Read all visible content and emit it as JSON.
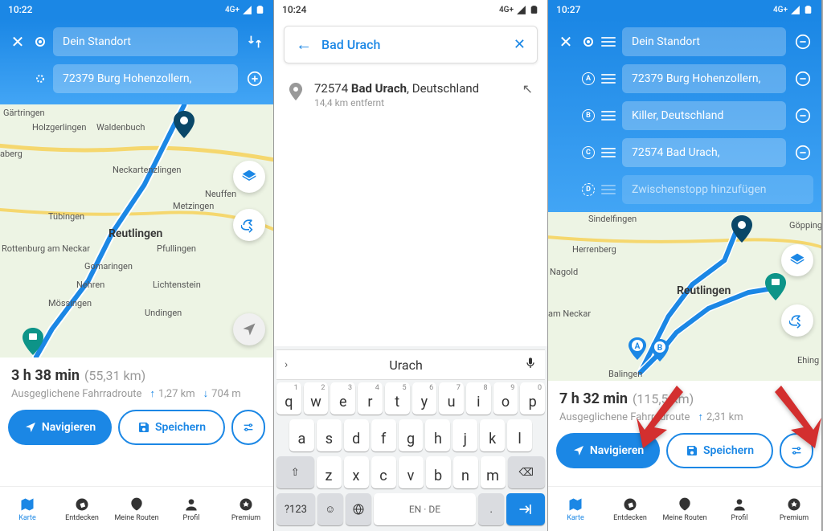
{
  "status": {
    "t1": "10:22",
    "t2": "10:24",
    "t3": "10:27",
    "net": "4G+"
  },
  "p1": {
    "origin": "Dein Standort",
    "dest": "72379 Burg Hohenzollern,",
    "cities": {
      "gartringen": "Gärtringen",
      "holzgerlingen": "Holzgerlingen",
      "waldenbuch": "Waldenbuch",
      "neckartenzlingen": "Neckartenzlingen",
      "metzingen": "Metzingen",
      "tubingen": "Tübingen",
      "reutlingen": "Reutlingen",
      "pfullingen": "Pfullingen",
      "rottenburg": "Rottenburg am Neckar",
      "gomaringen": "Gomaringen",
      "nehren": "Nehren",
      "lichtenstein": "Lichtenstein",
      "mossingen": "Mössingen",
      "undingen": "Undingen",
      "neuffen": "Neuffen",
      "aberg": "aberg"
    },
    "stats": {
      "time": "3 h 38 min",
      "dist": "(55,31 km)",
      "type": "Ausgeglichene Fahrradroute",
      "up": "1,27 km",
      "down": "704 m"
    },
    "nav": "Navigieren",
    "save": "Speichern"
  },
  "p2": {
    "query": "Bad Urach",
    "suggest": "Urach",
    "result": {
      "zip": "72574",
      "city": "Bad Urach",
      "country": ", Deutschland",
      "dist": "14,4 km entfernt"
    },
    "keys": {
      "r1": [
        "q",
        "w",
        "e",
        "r",
        "t",
        "y",
        "u",
        "i",
        "o",
        "p"
      ],
      "r1n": [
        "1",
        "2",
        "3",
        "4",
        "5",
        "6",
        "7",
        "8",
        "9",
        "0"
      ],
      "r2": [
        "a",
        "s",
        "d",
        "f",
        "g",
        "h",
        "j",
        "k",
        "l"
      ],
      "r3": [
        "z",
        "x",
        "c",
        "v",
        "b",
        "n",
        "m"
      ],
      "shift": "⇧",
      "del": "⌫",
      "num": "?123",
      "comma": ",",
      "lang": "EN · DE",
      "dot": "."
    }
  },
  "p3": {
    "origin": "Dein Standort",
    "stopA": "72379 Burg Hohenzollern,",
    "stopB": "Killer, Deutschland",
    "stopC": "72574 Bad Urach,",
    "add": "Zwischenstopp hinzufügen",
    "cities": {
      "sindelfingen": "Sindelfingen",
      "herrenberg": "Herrenberg",
      "nagold": "Nagold",
      "reutlingen": "Reutlingen",
      "neckar": "am Neckar",
      "balingen": "Balingen",
      "ehing": "Ehing",
      "gopping": "Göpping"
    },
    "stats": {
      "time": "7 h 32 min",
      "dist": "(115,5 km)",
      "type": "Ausgeglichene Fahrradroute",
      "up": "2,31 km"
    },
    "nav": "Navigieren",
    "save": "Speichern"
  },
  "tabs": {
    "karte": "Karte",
    "entdecken": "Entdecken",
    "routen": "Meine Routen",
    "profil": "Profil",
    "premium": "Premium"
  }
}
